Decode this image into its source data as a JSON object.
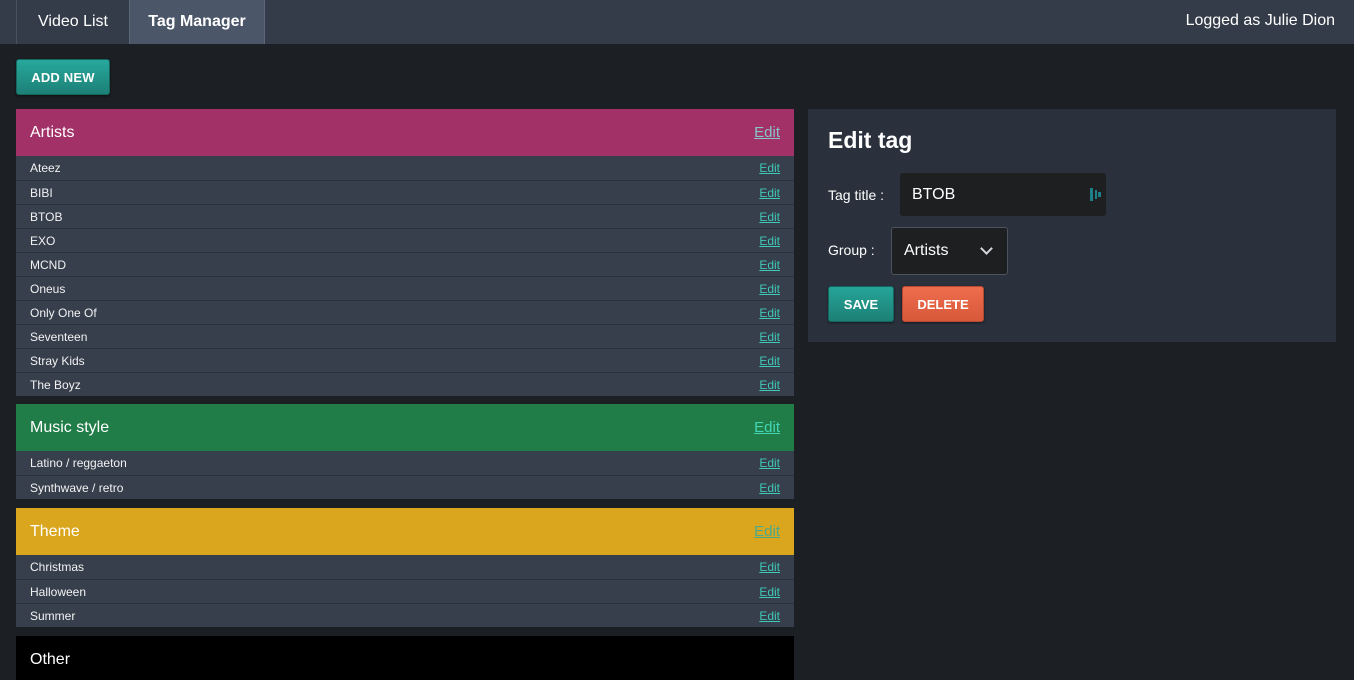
{
  "nav": {
    "tabs": [
      {
        "label": "Video List"
      },
      {
        "label": "Tag Manager"
      }
    ],
    "logged_text": "Logged as Julie Dion"
  },
  "toolbar": {
    "add_label": "ADD NEW"
  },
  "groups": [
    {
      "title": "Artists",
      "edit_label": "Edit",
      "color": "#a13166",
      "edit_color": "#88c5c9",
      "tags": [
        {
          "name": "Ateez",
          "edit": "Edit"
        },
        {
          "name": "BIBI",
          "edit": "Edit"
        },
        {
          "name": "BTOB",
          "edit": "Edit"
        },
        {
          "name": "EXO",
          "edit": "Edit"
        },
        {
          "name": "MCND",
          "edit": "Edit"
        },
        {
          "name": "Oneus",
          "edit": "Edit"
        },
        {
          "name": "Only One Of",
          "edit": "Edit"
        },
        {
          "name": "Seventeen",
          "edit": "Edit"
        },
        {
          "name": "Stray Kids",
          "edit": "Edit"
        },
        {
          "name": "The Boyz",
          "edit": "Edit"
        }
      ]
    },
    {
      "title": "Music style",
      "edit_label": "Edit",
      "color": "#207d47",
      "edit_color": "#43d6b6",
      "tags": [
        {
          "name": "Latino / reggaeton",
          "edit": "Edit"
        },
        {
          "name": "Synthwave / retro",
          "edit": "Edit"
        }
      ]
    },
    {
      "title": "Theme",
      "edit_label": "Edit",
      "color": "#daa61d",
      "edit_color": "#4ba98c",
      "tags": [
        {
          "name": "Christmas",
          "edit": "Edit"
        },
        {
          "name": "Halloween",
          "edit": "Edit"
        },
        {
          "name": "Summer",
          "edit": "Edit"
        }
      ]
    },
    {
      "title": "Other",
      "edit_label": "",
      "color": "#000000",
      "edit_color": "#3fc9b6",
      "tags": []
    }
  ],
  "edit_panel": {
    "title": "Edit tag",
    "tag_title_label": "Tag title :",
    "tag_title_value": "BTOB",
    "group_label": "Group :",
    "group_value": "Artists",
    "save_label": "SAVE",
    "delete_label": "DELETE"
  },
  "icons": [
    "chevron-down-icon",
    "input-helper-icon"
  ]
}
